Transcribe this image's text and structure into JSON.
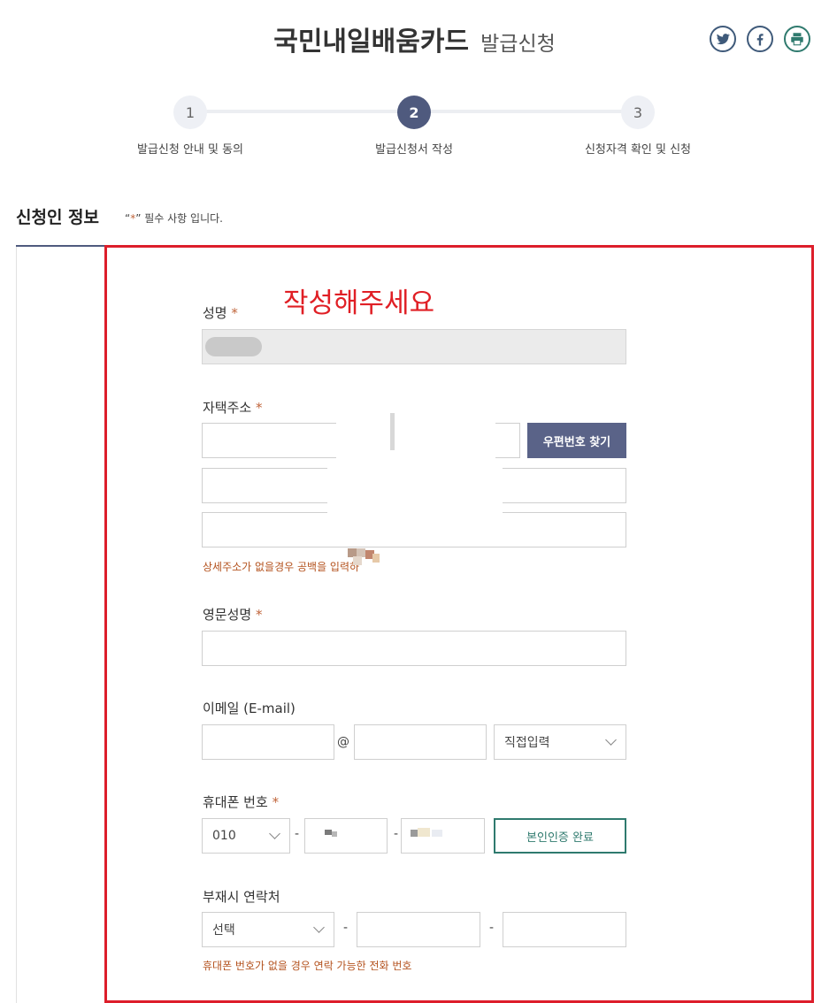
{
  "header": {
    "title_main": "국민내일배움카드",
    "title_sub": "발급신청",
    "share_icons": [
      "twitter-icon",
      "facebook-icon",
      "print-icon"
    ]
  },
  "stepper": {
    "steps": [
      {
        "number": "1",
        "label": "발급신청 안내 및 동의",
        "active": false
      },
      {
        "number": "2",
        "label": "발급신청서 작성",
        "active": true
      },
      {
        "number": "3",
        "label": "신청자격 확인 및 신청",
        "active": false
      }
    ]
  },
  "section": {
    "title": "신청인 정보",
    "required_note_open": "“",
    "required_note_star": "*",
    "required_note_close": "” 필수 사항 입니다."
  },
  "annotation": "작성해주세요",
  "form": {
    "name": {
      "label": "성명",
      "required_mark": "*"
    },
    "address": {
      "label": "자택주소",
      "required_mark": "*",
      "postal_button": "우편번호 찾기",
      "note": "상세주소가 없을경우 공백을 입력하"
    },
    "english_name": {
      "label": "영문성명",
      "required_mark": "*"
    },
    "email": {
      "label": "이메일 (E-mail)",
      "at": "@",
      "domain_select": "직접입력"
    },
    "mobile": {
      "label": "휴대폰 번호",
      "required_mark": "*",
      "prefix": "010",
      "dash": "-",
      "verify_button": "본인인증 완료"
    },
    "alt_contact": {
      "label": "부재시 연락처",
      "prefix_select": "선택",
      "dash": "-",
      "note": "휴대폰 번호가 없을 경우 연락 가능한 전화 번호"
    }
  },
  "colors": {
    "accent": "#4f5a7e",
    "required": "#c0643a",
    "highlight_box": "#dd1e2b",
    "verify": "#2f7a6e"
  }
}
